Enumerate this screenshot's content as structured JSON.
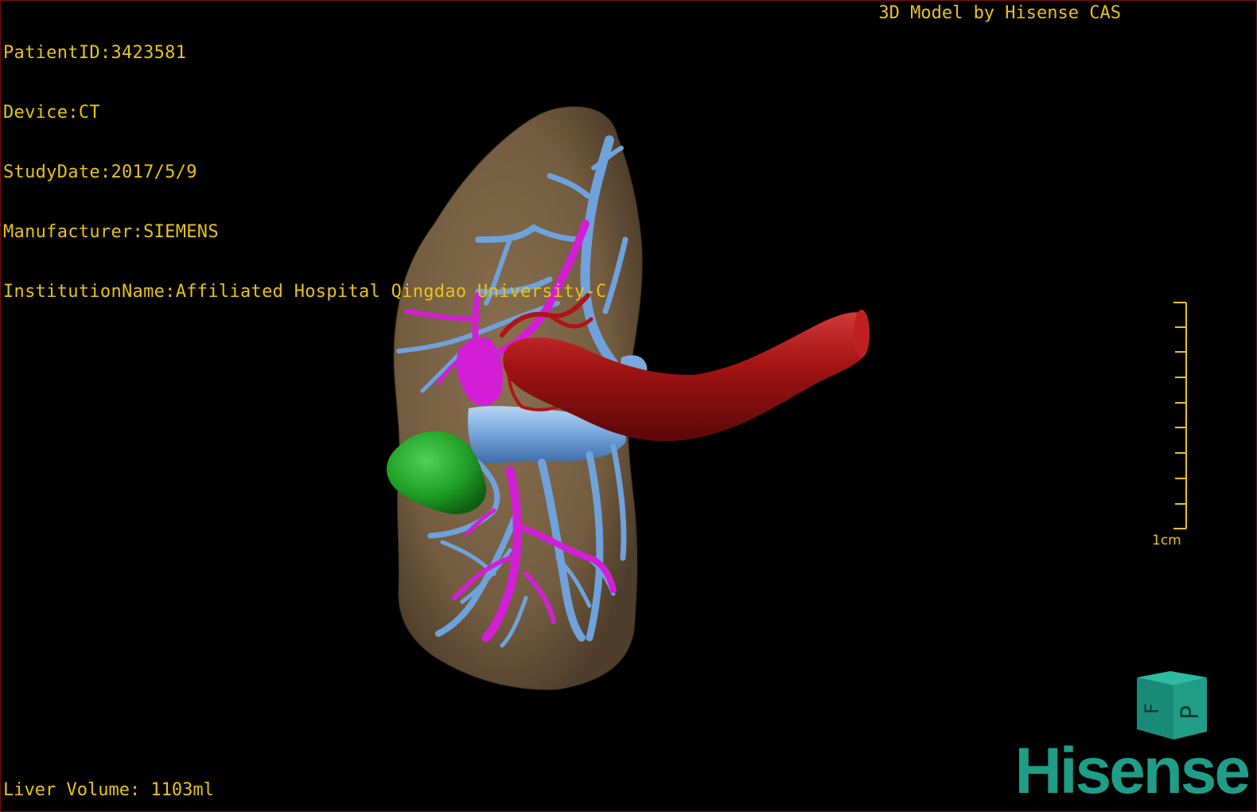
{
  "header": {
    "patient_id": "PatientID:3423581",
    "device": "Device:CT",
    "study_date": "StudyDate:2017/5/9",
    "manufacturer": "Manufacturer:SIEMENS",
    "institution": "InstitutionName:Affiliated Hospital Qingdao University-C"
  },
  "credit": "3D Model by Hisense CAS",
  "footer": {
    "liver_volume": "Liver Volume: 1103ml"
  },
  "scale_bar": {
    "label": "1cm"
  },
  "orientation_cube": {
    "face_front": "P",
    "face_left": "F"
  },
  "logo": "Hisense",
  "colors": {
    "overlay_text": "#e8c21a",
    "liver": "#7d6548",
    "portal_veins": "#6fa2dc",
    "hepatic_veins": "#d21fd6",
    "arteries": "#8e0d0d",
    "tumor": "#22a52a",
    "logo": "#1f9d87",
    "cube": "#1f9d87"
  }
}
